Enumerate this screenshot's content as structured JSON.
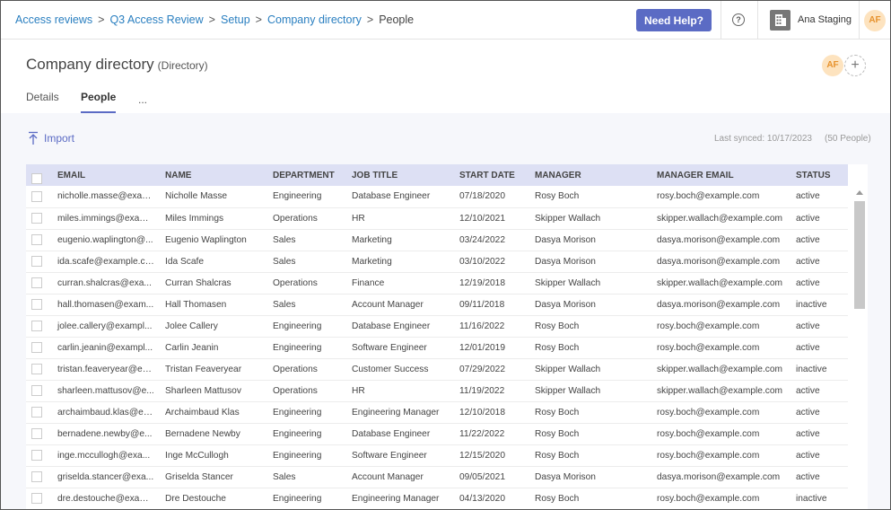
{
  "breadcrumb": {
    "items": [
      "Access reviews",
      "Q3 Access Review",
      "Setup",
      "Company directory"
    ],
    "current": "People",
    "separator": ">"
  },
  "topbar": {
    "help_label": "Need Help?",
    "help_icon": "?",
    "org_name": "Ana Staging",
    "user_initials": "AF"
  },
  "header": {
    "title": "Company directory",
    "subtitle": "(Directory)",
    "owner_initials": "AF",
    "add_label": "+"
  },
  "tabs": [
    {
      "label": "Details"
    },
    {
      "label": "People"
    },
    {
      "label": "..."
    }
  ],
  "toolbar": {
    "import_label": "Import",
    "last_synced": "Last synced: 10/17/2023",
    "people_count": "(50 People)"
  },
  "table": {
    "columns": [
      "EMAIL",
      "NAME",
      "DEPARTMENT",
      "JOB TITLE",
      "START DATE",
      "MANAGER",
      "MANAGER EMAIL",
      "STATUS"
    ],
    "rows": [
      [
        "nicholle.masse@exam...",
        "Nicholle Masse",
        "Engineering",
        "Database Engineer",
        "07/18/2020",
        "Rosy Boch",
        "rosy.boch@example.com",
        "active"
      ],
      [
        "miles.immings@exam...",
        "Miles Immings",
        "Operations",
        "HR",
        "12/10/2021",
        "Skipper Wallach",
        "skipper.wallach@example.com",
        "active"
      ],
      [
        "eugenio.waplington@...",
        "Eugenio Waplington",
        "Sales",
        "Marketing",
        "03/24/2022",
        "Dasya Morison",
        "dasya.morison@example.com",
        "active"
      ],
      [
        "ida.scafe@example.co...",
        "Ida Scafe",
        "Sales",
        "Marketing",
        "03/10/2022",
        "Dasya Morison",
        "dasya.morison@example.com",
        "active"
      ],
      [
        "curran.shalcras@exa...",
        "Curran Shalcras",
        "Operations",
        "Finance",
        "12/19/2018",
        "Skipper Wallach",
        "skipper.wallach@example.com",
        "active"
      ],
      [
        "hall.thomasen@exam...",
        "Hall Thomasen",
        "Sales",
        "Account Manager",
        "09/11/2018",
        "Dasya Morison",
        "dasya.morison@example.com",
        "inactive"
      ],
      [
        "jolee.callery@exampl...",
        "Jolee Callery",
        "Engineering",
        "Database Engineer",
        "11/16/2022",
        "Rosy Boch",
        "rosy.boch@example.com",
        "active"
      ],
      [
        "carlin.jeanin@exampl...",
        "Carlin Jeanin",
        "Engineering",
        "Software Engineer",
        "12/01/2019",
        "Rosy Boch",
        "rosy.boch@example.com",
        "active"
      ],
      [
        "tristan.feaveryear@ex...",
        "Tristan Feaveryear",
        "Operations",
        "Customer Success",
        "07/29/2022",
        "Skipper Wallach",
        "skipper.wallach@example.com",
        "inactive"
      ],
      [
        "sharleen.mattusov@e...",
        "Sharleen Mattusov",
        "Operations",
        "HR",
        "11/19/2022",
        "Skipper Wallach",
        "skipper.wallach@example.com",
        "active"
      ],
      [
        "archaimbaud.klas@ex...",
        "Archaimbaud Klas",
        "Engineering",
        "Engineering Manager",
        "12/10/2018",
        "Rosy Boch",
        "rosy.boch@example.com",
        "active"
      ],
      [
        "bernadene.newby@e...",
        "Bernadene Newby",
        "Engineering",
        "Database Engineer",
        "11/22/2022",
        "Rosy Boch",
        "rosy.boch@example.com",
        "active"
      ],
      [
        "inge.mccullogh@exa...",
        "Inge McCullogh",
        "Engineering",
        "Software Engineer",
        "12/15/2020",
        "Rosy Boch",
        "rosy.boch@example.com",
        "active"
      ],
      [
        "griselda.stancer@exa...",
        "Griselda Stancer",
        "Sales",
        "Account Manager",
        "09/05/2021",
        "Dasya Morison",
        "dasya.morison@example.com",
        "active"
      ],
      [
        "dre.destouche@exam...",
        "Dre Destouche",
        "Engineering",
        "Engineering Manager",
        "04/13/2020",
        "Rosy Boch",
        "rosy.boch@example.com",
        "inactive"
      ]
    ]
  },
  "colors": {
    "accent": "#5b6bc4",
    "link": "#2a7fc0",
    "header_bg": "#dde0f4",
    "avatar_bg": "#fde3bf",
    "avatar_fg": "#e7922d"
  }
}
